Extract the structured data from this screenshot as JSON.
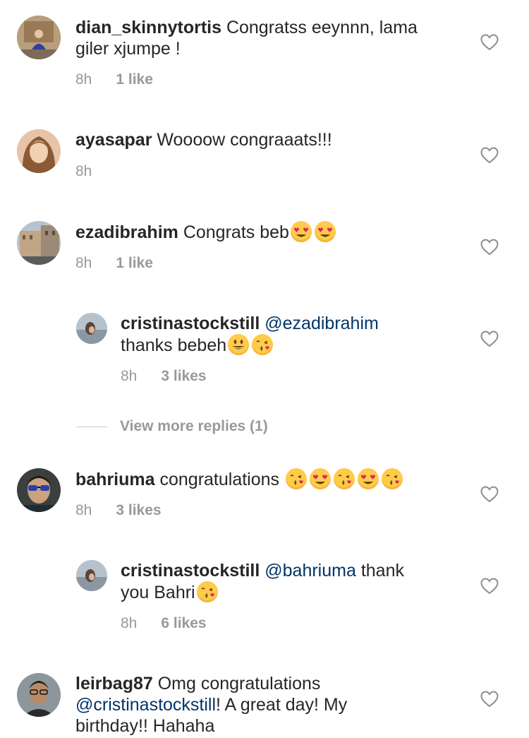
{
  "comments": [
    {
      "username": "dian_skinnytortis",
      "text": " Congratss eeynnn, lama",
      "text2": "giler xjumpe !",
      "time": "8h",
      "likes": "1 like"
    },
    {
      "username": "ayasapar",
      "text": " Woooow congraaats!!!",
      "time": "8h"
    },
    {
      "username": "ezadibrahim",
      "text": " Congrats beb",
      "time": "8h",
      "likes": "1 like"
    },
    {
      "username": "cristinastockstill",
      "mention": "@ezadibrahim",
      "text2": "thanks bebeh",
      "time": "8h",
      "likes": "3 likes"
    },
    {
      "username": "bahriuma",
      "text": " congratulations ",
      "time": "8h",
      "likes": "3 likes"
    },
    {
      "username": "cristinastockstill",
      "mention": "@bahriuma",
      "text": " thank",
      "text2": "you Bahri",
      "time": "8h",
      "likes": "6 likes"
    },
    {
      "username": "leirbag87",
      "text": " Omg congratulations",
      "mention": "@cristinastockstill",
      "text2": "! A great day! My",
      "text3": "birthday!! Hahaha"
    }
  ],
  "view_more_replies": "View more replies (1)",
  "colors": {
    "text": "#262626",
    "meta": "#999999",
    "mention": "#003569",
    "emoji": "#ffcb4c"
  },
  "icons": {
    "like": "heart-outline-icon",
    "emoji_heart_eyes": "heart-eyes-emoji",
    "emoji_kiss": "face-blowing-kiss-emoji",
    "emoji_smile": "grinning-face-emoji"
  }
}
